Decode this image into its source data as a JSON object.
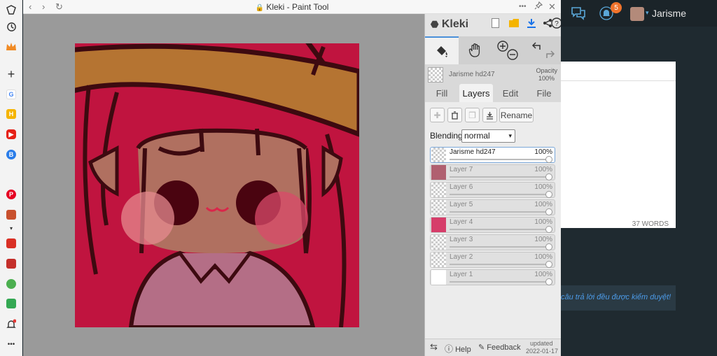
{
  "window": {
    "title": "Kleki - Paint Tool",
    "more": "•••",
    "pin": "⊿",
    "close": "✕",
    "back": "‹",
    "forward": "›",
    "reload": "↻",
    "lock": "🔒"
  },
  "left_sidebar": {
    "items": [
      "history-icon",
      "crown-icon",
      "add-icon",
      "google-icon",
      "h-icon",
      "youtube-icon",
      "bookmark-icon",
      "pinterest-icon",
      "shield-icon",
      "gift-icon",
      "tiki-icon",
      "chat-icon",
      "grid-icon",
      "bell-icon",
      "more-icon"
    ],
    "labels": {
      "google": "G",
      "h": "H",
      "more": "•••",
      "add": "+"
    }
  },
  "panel": {
    "brand": "Kleki",
    "current_layer": "Jarisme hd247",
    "opacity_label": "Opacity",
    "opacity_value": "100%",
    "tabs": [
      "Fill",
      "Layers",
      "Edit",
      "File"
    ],
    "active_tab": "Layers",
    "rename": "Rename",
    "blending_label": "Blending",
    "blending_value": "normal",
    "layers": [
      {
        "name": "Jarisme hd247",
        "opacity": "100%",
        "active": true
      },
      {
        "name": "Layer 7",
        "opacity": "100%"
      },
      {
        "name": "Layer 6",
        "opacity": "100%"
      },
      {
        "name": "Layer 5",
        "opacity": "100%"
      },
      {
        "name": "Layer 4",
        "opacity": "100%"
      },
      {
        "name": "Layer 3",
        "opacity": "100%"
      },
      {
        "name": "Layer 2",
        "opacity": "100%"
      },
      {
        "name": "Layer 1",
        "opacity": "100%"
      }
    ],
    "footer": {
      "help": "Help",
      "feedback": "Feedback",
      "updated": "updated",
      "updated_date": "2022-01-17"
    }
  },
  "site": {
    "username": "Jarisme",
    "notification_count": "5",
    "word_count": "37 WORDS",
    "notice": "câu trả lời đều được kiểm duyệt!"
  }
}
